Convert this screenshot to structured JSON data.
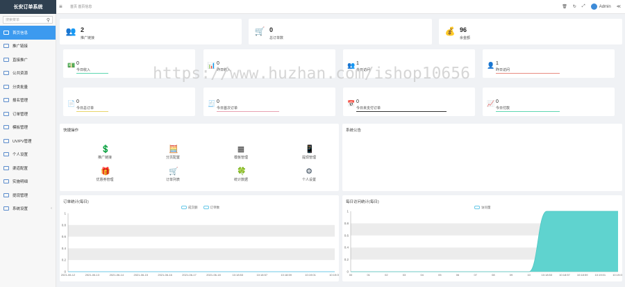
{
  "app": {
    "title": "长安订单系统"
  },
  "topbar": {
    "breadcrumb": "首页 首页信息",
    "user": "Admin"
  },
  "sidebar": {
    "search_placeholder": "搜索菜单",
    "items": [
      {
        "label": "首页信息",
        "active": true
      },
      {
        "label": "推广链接"
      },
      {
        "label": "直接推广"
      },
      {
        "label": "公共资源"
      },
      {
        "label": "分类批量"
      },
      {
        "label": "报名管理"
      },
      {
        "label": "订单管理"
      },
      {
        "label": "模板管理"
      },
      {
        "label": "UV/PV管理"
      },
      {
        "label": "个人设置"
      },
      {
        "label": "渠道配置"
      },
      {
        "label": "实施明细"
      },
      {
        "label": "提现管理"
      },
      {
        "label": "系统设置",
        "has_children": true
      }
    ]
  },
  "stats": [
    {
      "value": "2",
      "label": "推广链接",
      "icon": "people-icon"
    },
    {
      "value": "0",
      "label": "总订单数",
      "icon": "cart-icon"
    },
    {
      "value": "96",
      "label": "余金额",
      "icon": "money-bag-icon"
    }
  ],
  "mini_row1": [
    {
      "value": "0",
      "label": "今日收入",
      "color": "#5cd6b0"
    },
    {
      "value": "0",
      "label": "昨日收入",
      "color": "#ffffff"
    },
    {
      "value": "1",
      "label": "今日访问",
      "color": "#ffffff"
    },
    {
      "value": "1",
      "label": "昨日访问",
      "color": "#e88a80"
    }
  ],
  "mini_row2": [
    {
      "value": "0",
      "label": "今日总订单",
      "color": "#e8d56a"
    },
    {
      "value": "0",
      "label": "今日首次订单",
      "color": "#e8a0b0"
    },
    {
      "value": "0",
      "label": "今日未支付订单",
      "color": "#333333"
    },
    {
      "value": "0",
      "label": "今日付款",
      "color": "#5cd6b0"
    }
  ],
  "quick": {
    "title": "快捷操作",
    "items": [
      {
        "label": "推广链接",
        "icon": "money-icon"
      },
      {
        "label": "分页配置",
        "icon": "calculator-icon"
      },
      {
        "label": "模板管理",
        "icon": "grid-icon"
      },
      {
        "label": "提现管理",
        "icon": "phone-icon"
      },
      {
        "label": "优惠券管理",
        "icon": "gift-icon"
      },
      {
        "label": "订单列表",
        "icon": "cart-icon"
      },
      {
        "label": "统计数据",
        "icon": "chart-icon"
      },
      {
        "label": "个人设置",
        "icon": "settings-icon"
      }
    ]
  },
  "notice": {
    "title": "系统公告"
  },
  "order_chart": {
    "title": "订单统计(每日)",
    "legend": [
      "成交额",
      "订单数"
    ]
  },
  "visit_chart": {
    "title": "每日访问统计(每日)",
    "legend": [
      "访问量"
    ]
  },
  "watermark": "https://www.huzhan.com/ishop10656",
  "chart_data": [
    {
      "type": "line",
      "title": "订单统计(每日)",
      "x": [
        "2021-06-12",
        "2021-06-13",
        "2021-06-14",
        "2021-06-15",
        "2021-06-16",
        "2021-06-17",
        "2021-06-18",
        "10:18:53",
        "10:18:57",
        "10:18:59",
        "10:19:01",
        "10:19:05"
      ],
      "series": [
        {
          "name": "成交额",
          "values": [
            0,
            0,
            0,
            0,
            0,
            0,
            0,
            0,
            0,
            0,
            0,
            0
          ]
        },
        {
          "name": "订单数",
          "values": [
            0,
            0,
            0,
            0,
            0,
            0,
            0,
            0,
            0,
            0,
            0,
            0
          ]
        }
      ],
      "ylim": [
        0,
        1
      ],
      "yticks": [
        "0",
        "0.2",
        "0.4",
        "0.6",
        "0.8",
        "1"
      ],
      "grid": true
    },
    {
      "type": "area",
      "title": "每日访问统计(每日)",
      "x": [
        "00",
        "01",
        "02",
        "03",
        "04",
        "05",
        "06",
        "07",
        "08",
        "09",
        "10",
        "10:18:53",
        "10:18:57",
        "10:18:59",
        "10:19:01",
        "10:19:05"
      ],
      "series": [
        {
          "name": "访问量",
          "values": [
            0,
            0,
            0,
            0,
            0,
            0,
            0,
            0,
            0,
            0,
            0,
            1,
            1,
            1,
            1,
            1
          ]
        }
      ],
      "ylim": [
        0,
        1
      ],
      "yticks": [
        "0",
        "0.2",
        "0.4",
        "0.6",
        "0.8",
        "1"
      ],
      "grid": true
    }
  ]
}
